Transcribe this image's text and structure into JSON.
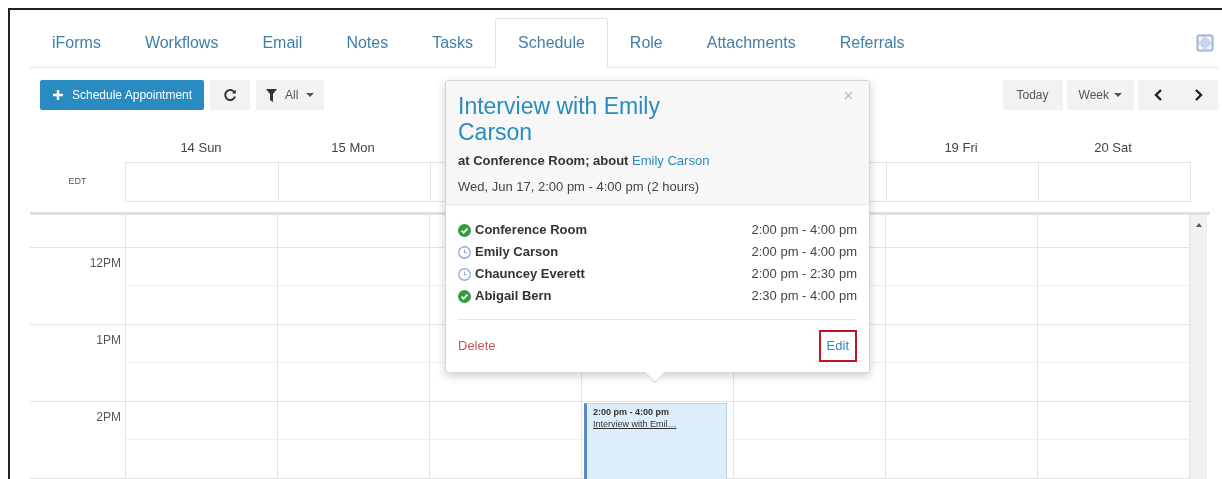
{
  "tabs": [
    {
      "label": "iForms",
      "selected": false
    },
    {
      "label": "Workflows",
      "selected": false
    },
    {
      "label": "Email",
      "selected": false
    },
    {
      "label": "Notes",
      "selected": false
    },
    {
      "label": "Tasks",
      "selected": false
    },
    {
      "label": "Schedule",
      "selected": true
    },
    {
      "label": "Role",
      "selected": false
    },
    {
      "label": "Attachments",
      "selected": false
    },
    {
      "label": "Referrals",
      "selected": false
    }
  ],
  "toolbar": {
    "primary": "Schedule Appointment",
    "filter": "All",
    "today": "Today",
    "view": "Week"
  },
  "calendar": {
    "timezone": "EDT",
    "days_before_popover": [
      {
        "label": "14 Sun"
      },
      {
        "label": "15 Mon"
      }
    ],
    "days_after_popover": [
      {
        "label": "19 Fri"
      },
      {
        "label": "20 Sat"
      }
    ],
    "events": [
      {
        "time": "2:00 pm - 4:00 pm",
        "title": "Interview with Emil…"
      }
    ],
    "hours": [
      {
        "label": "12PM"
      },
      {
        "label": "1PM"
      },
      {
        "label": "2PM"
      }
    ]
  },
  "popover": {
    "title": "Interview with Emily Carson",
    "location": "at Conference Room; about ",
    "about_link": "Emily Carson",
    "when": "Wed, Jun 17, 2:00 pm - 4:00 pm (2 hours)",
    "attendees": [
      {
        "name": "Conference Room",
        "time": "2:00 pm - 4:00 pm",
        "confirmed": true
      },
      {
        "name": "Emily Carson",
        "time": "2:00 pm - 4:00 pm",
        "confirmed": false
      },
      {
        "name": "Chauncey Everett",
        "time": "2:00 pm - 2:30 pm",
        "confirmed": false
      },
      {
        "name": "Abigail Bern",
        "time": "2:30 pm - 4:00 pm",
        "confirmed": true
      }
    ],
    "delete": "Delete",
    "edit": {
      "label": "Edit",
      "highlighted": true
    }
  }
}
